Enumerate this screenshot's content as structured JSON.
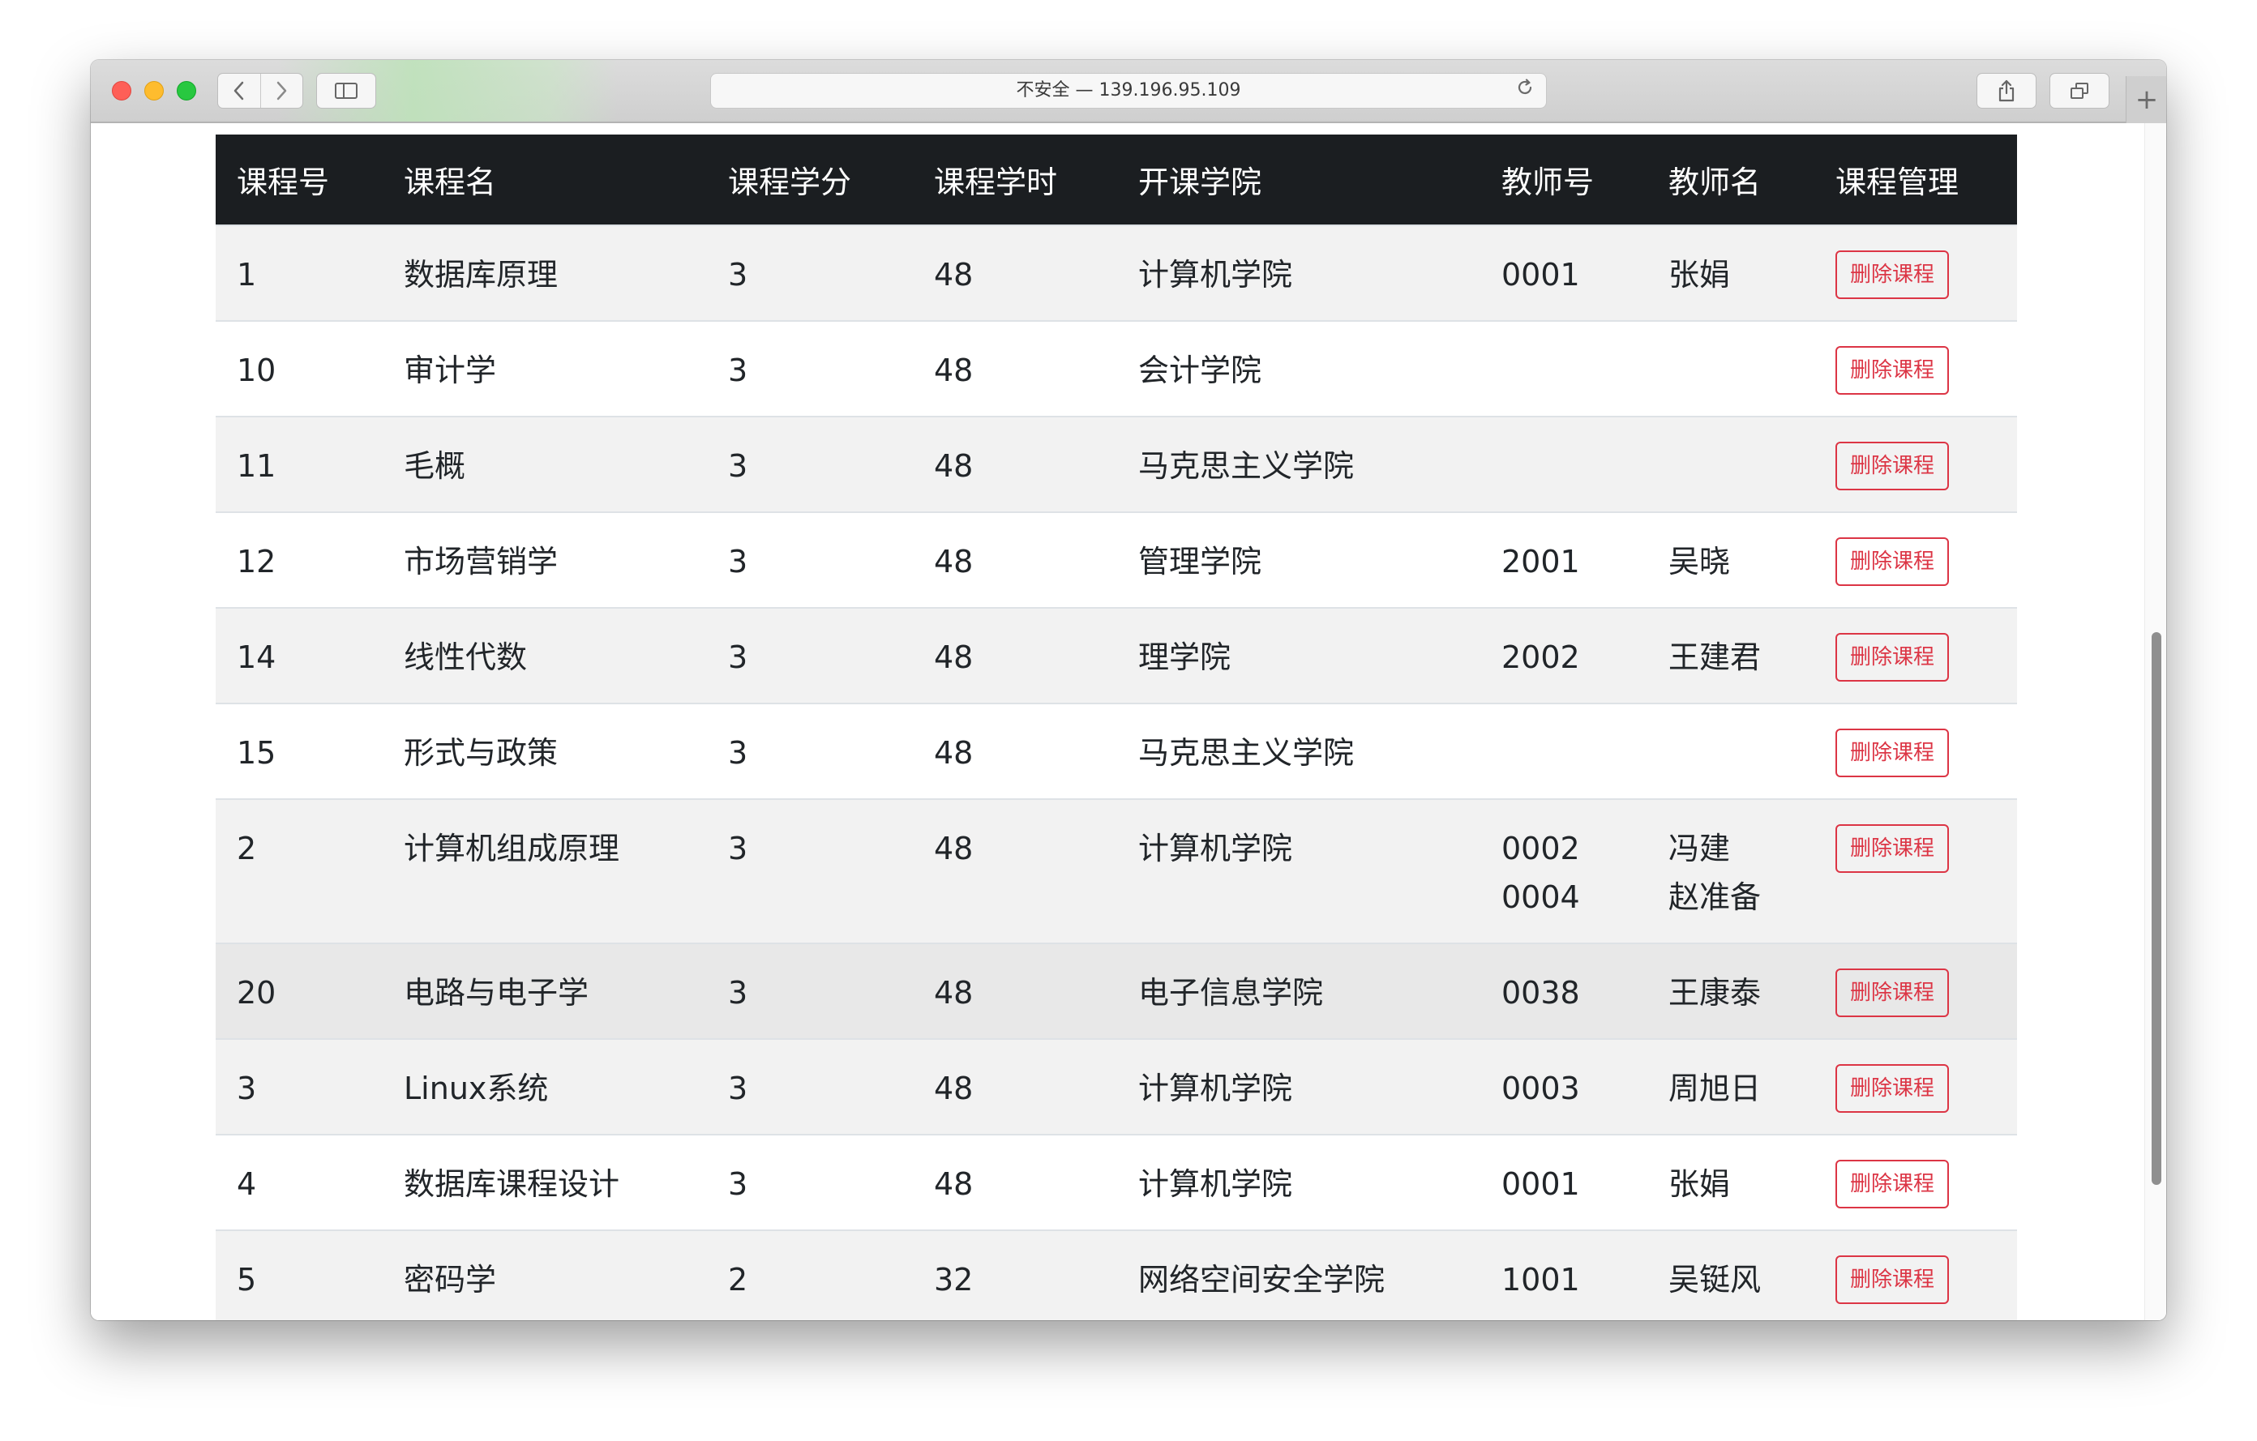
{
  "browser": {
    "url_text": "不安全 — 139.196.95.109",
    "back_icon": "chevron-left-icon",
    "forward_icon": "chevron-right-icon",
    "reload_icon": "reload-icon",
    "share_icon": "share-icon",
    "tabs_icon": "tabs-overview-icon",
    "new_tab_label": "+"
  },
  "table": {
    "headers": [
      "课程号",
      "课程名",
      "课程学分",
      "课程学时",
      "开课学院",
      "教师号",
      "教师名",
      "课程管理"
    ],
    "delete_label": "删除课程",
    "rows": [
      {
        "id": "1",
        "name": "数据库原理",
        "credit": "3",
        "hours": "48",
        "college": "计算机学院",
        "teacher_ids": [
          "0001"
        ],
        "teacher_names": [
          "张娟"
        ]
      },
      {
        "id": "10",
        "name": "审计学",
        "credit": "3",
        "hours": "48",
        "college": "会计学院",
        "teacher_ids": [],
        "teacher_names": []
      },
      {
        "id": "11",
        "name": "毛概",
        "credit": "3",
        "hours": "48",
        "college": "马克思主义学院",
        "teacher_ids": [],
        "teacher_names": []
      },
      {
        "id": "12",
        "name": "市场营销学",
        "credit": "3",
        "hours": "48",
        "college": "管理学院",
        "teacher_ids": [
          "2001"
        ],
        "teacher_names": [
          "吴晓"
        ]
      },
      {
        "id": "14",
        "name": "线性代数",
        "credit": "3",
        "hours": "48",
        "college": "理学院",
        "teacher_ids": [
          "2002"
        ],
        "teacher_names": [
          "王建君"
        ]
      },
      {
        "id": "15",
        "name": "形式与政策",
        "credit": "3",
        "hours": "48",
        "college": "马克思主义学院",
        "teacher_ids": [],
        "teacher_names": []
      },
      {
        "id": "2",
        "name": "计算机组成原理",
        "credit": "3",
        "hours": "48",
        "college": "计算机学院",
        "teacher_ids": [
          "0002",
          "0004"
        ],
        "teacher_names": [
          "冯建",
          "赵准备"
        ]
      },
      {
        "id": "20",
        "name": "电路与电子学",
        "credit": "3",
        "hours": "48",
        "college": "电子信息学院",
        "teacher_ids": [
          "0038"
        ],
        "teacher_names": [
          "王康泰"
        ],
        "highlight": true
      },
      {
        "id": "3",
        "name": "Linux系统",
        "credit": "3",
        "hours": "48",
        "college": "计算机学院",
        "teacher_ids": [
          "0003"
        ],
        "teacher_names": [
          "周旭日"
        ]
      },
      {
        "id": "4",
        "name": "数据库课程设计",
        "credit": "3",
        "hours": "48",
        "college": "计算机学院",
        "teacher_ids": [
          "0001"
        ],
        "teacher_names": [
          "张娟"
        ]
      },
      {
        "id": "5",
        "name": "密码学",
        "credit": "2",
        "hours": "32",
        "college": "网络空间安全学院",
        "teacher_ids": [
          "1001"
        ],
        "teacher_names": [
          "吴铤风"
        ]
      }
    ]
  }
}
